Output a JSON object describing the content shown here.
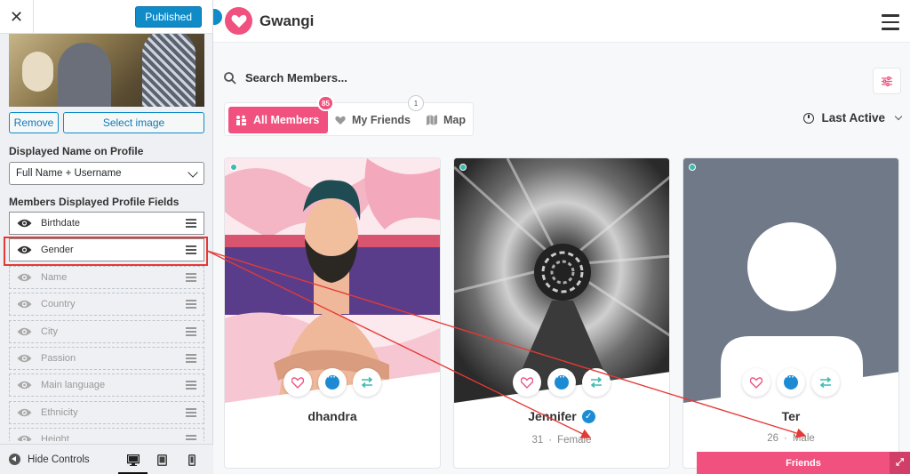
{
  "customizer": {
    "close_label": "✕",
    "publish_label": "Published",
    "remove_label": "Remove",
    "select_image_label": "Select image",
    "displayed_name_heading": "Displayed Name on Profile",
    "displayed_name_value": "Full Name + Username",
    "fields_heading": "Members Displayed Profile Fields",
    "fields": [
      {
        "label": "Birthdate",
        "visible": true
      },
      {
        "label": "Gender",
        "visible": true,
        "highlighted": true
      },
      {
        "label": "Name",
        "visible": false
      },
      {
        "label": "Country",
        "visible": false
      },
      {
        "label": "City",
        "visible": false
      },
      {
        "label": "Passion",
        "visible": false
      },
      {
        "label": "Main language",
        "visible": false
      },
      {
        "label": "Ethnicity",
        "visible": false
      },
      {
        "label": "Height",
        "visible": false
      }
    ],
    "hide_controls_label": "Hide Controls",
    "devices": [
      "desktop-icon",
      "tablet-icon",
      "mobile-icon"
    ]
  },
  "site": {
    "brand": "Gwangi",
    "search_placeholder": "Search Members...",
    "tabs": [
      {
        "label": "All Members",
        "badge": "85",
        "active": true,
        "icon": "members-icon"
      },
      {
        "label": "My Friends",
        "badge": "1",
        "active": false,
        "icon": "heart-icon"
      },
      {
        "label": "Map",
        "badge": "",
        "active": false,
        "icon": "map-icon"
      }
    ],
    "sort_label": "Last Active",
    "members": [
      {
        "name": "dhandra",
        "verified": false,
        "age": "",
        "gender": "",
        "online": true
      },
      {
        "name": "Jennifer",
        "verified": true,
        "age": "31",
        "gender": "Female",
        "online": true
      },
      {
        "name": "Ter",
        "verified": false,
        "age": "26",
        "gender": "Male",
        "online": true
      }
    ],
    "meta_separator": "·",
    "friends_bar_label": "Friends"
  },
  "colors": {
    "accent": "#f0517e",
    "wp_blue": "#0f8cc8",
    "online": "#3cbcb0",
    "annotation_red": "#e53935"
  }
}
